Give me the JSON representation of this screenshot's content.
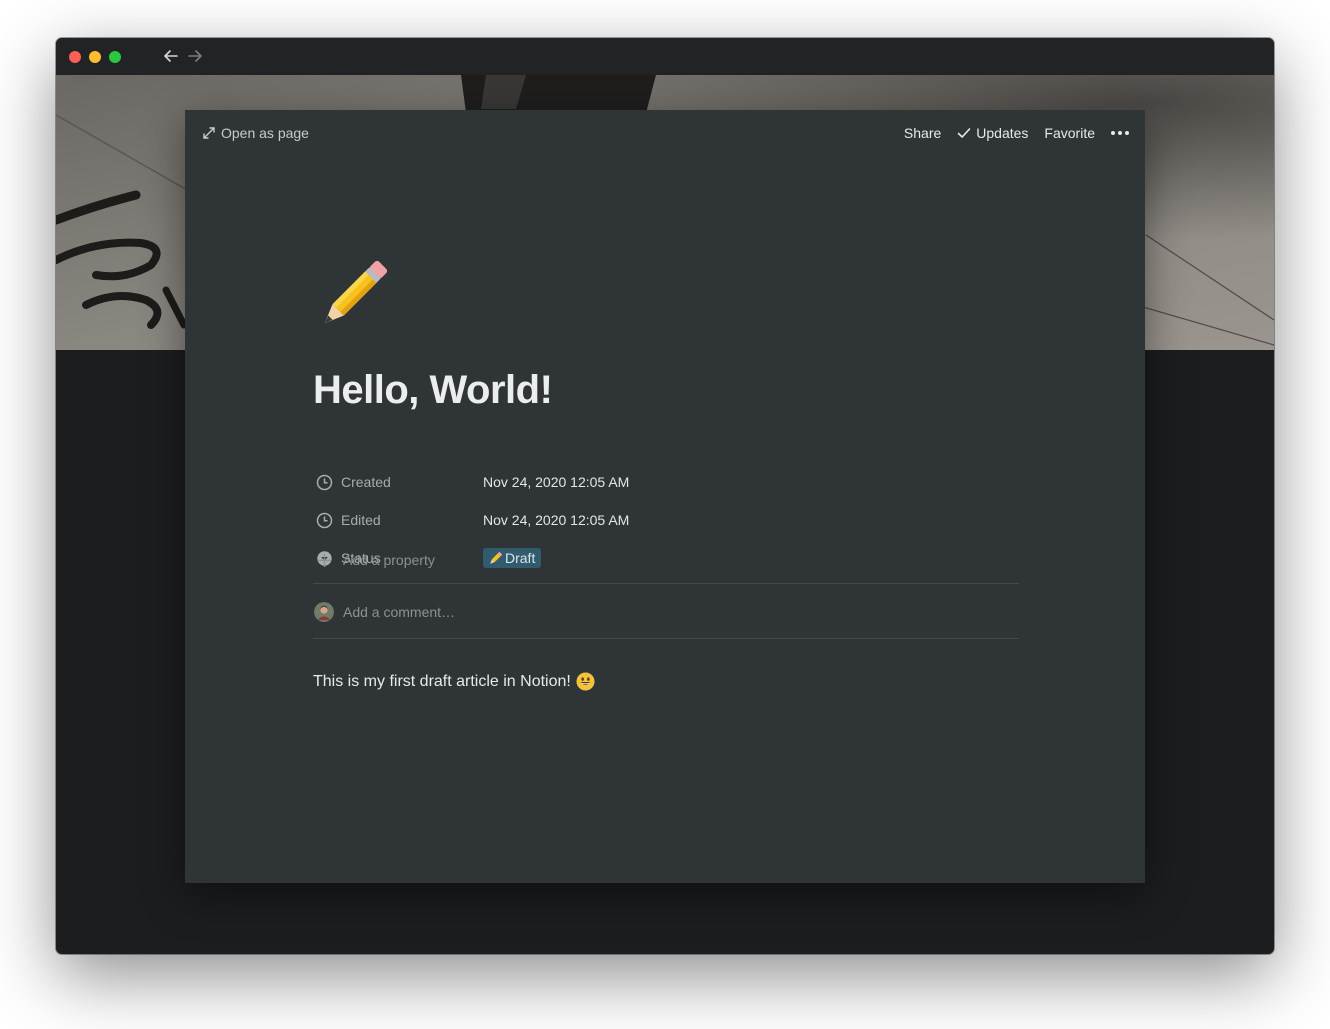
{
  "window": {
    "controls": [
      "close",
      "minimize",
      "zoom"
    ],
    "nav": {
      "back_icon": "arrow-left-icon",
      "forward_icon": "arrow-right-icon"
    }
  },
  "topbar": {
    "open_as_page": "Open as page",
    "share": "Share",
    "updates": "Updates",
    "favorite": "Favorite",
    "more_icon": "more-dots-icon"
  },
  "page": {
    "icon": "pencil-emoji",
    "title": "Hello, World!",
    "properties": [
      {
        "icon": "clock-icon",
        "label": "Created",
        "value": "Nov 24, 2020 12:05 AM"
      },
      {
        "icon": "clock-icon",
        "label": "Edited",
        "value": "Nov 24, 2020 12:05 AM"
      },
      {
        "icon": "select-icon",
        "label": "Status",
        "value": "Draft",
        "value_icon": "pencil-emoji",
        "tag_color": "#335b6e"
      }
    ],
    "add_property": "Add a property",
    "comment_placeholder": "Add a comment…",
    "body_text": "This is my first draft article in Notion!",
    "body_emoji": "grinning-face-emoji"
  },
  "colors": {
    "modal_bg": "#2f3437",
    "window_bg": "#1b1d1f",
    "titlebar_bg": "#212325",
    "status_tag": "#335b6e"
  }
}
